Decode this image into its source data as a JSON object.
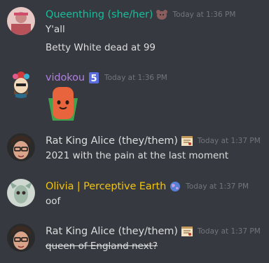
{
  "messages": [
    {
      "username": "Queenthing (she/her)",
      "username_color": "#1abc9c",
      "role_icon": "bear-icon",
      "timestamp": "Today at 1:36 PM",
      "lines": [
        "Y'all",
        "Betty White dead at 99"
      ]
    },
    {
      "username": "vidokou",
      "username_color": "#b07fe0",
      "role_icon": "number-5-icon",
      "timestamp": "Today at 1:36 PM",
      "sticker": "carrot-sticker"
    },
    {
      "username": "Rat King Alice (they/them)",
      "username_color": "#dcddde",
      "role_icon": "scroll-icon",
      "timestamp": "Today at 1:37 PM",
      "lines": [
        "2021 with the pain at the last moment"
      ]
    },
    {
      "username": "Olivia | Perceptive Earth",
      "username_color": "#f1c40f",
      "role_icon": "earth-icon",
      "timestamp": "Today at 1:37 PM",
      "lines": [
        "oof"
      ]
    },
    {
      "username": "Rat King Alice (they/them)",
      "username_color": "#dcddde",
      "role_icon": "scroll-icon",
      "timestamp": "Today at 1:37 PM",
      "lines": [
        "queen of England next?"
      ],
      "strikethrough": true
    }
  ]
}
